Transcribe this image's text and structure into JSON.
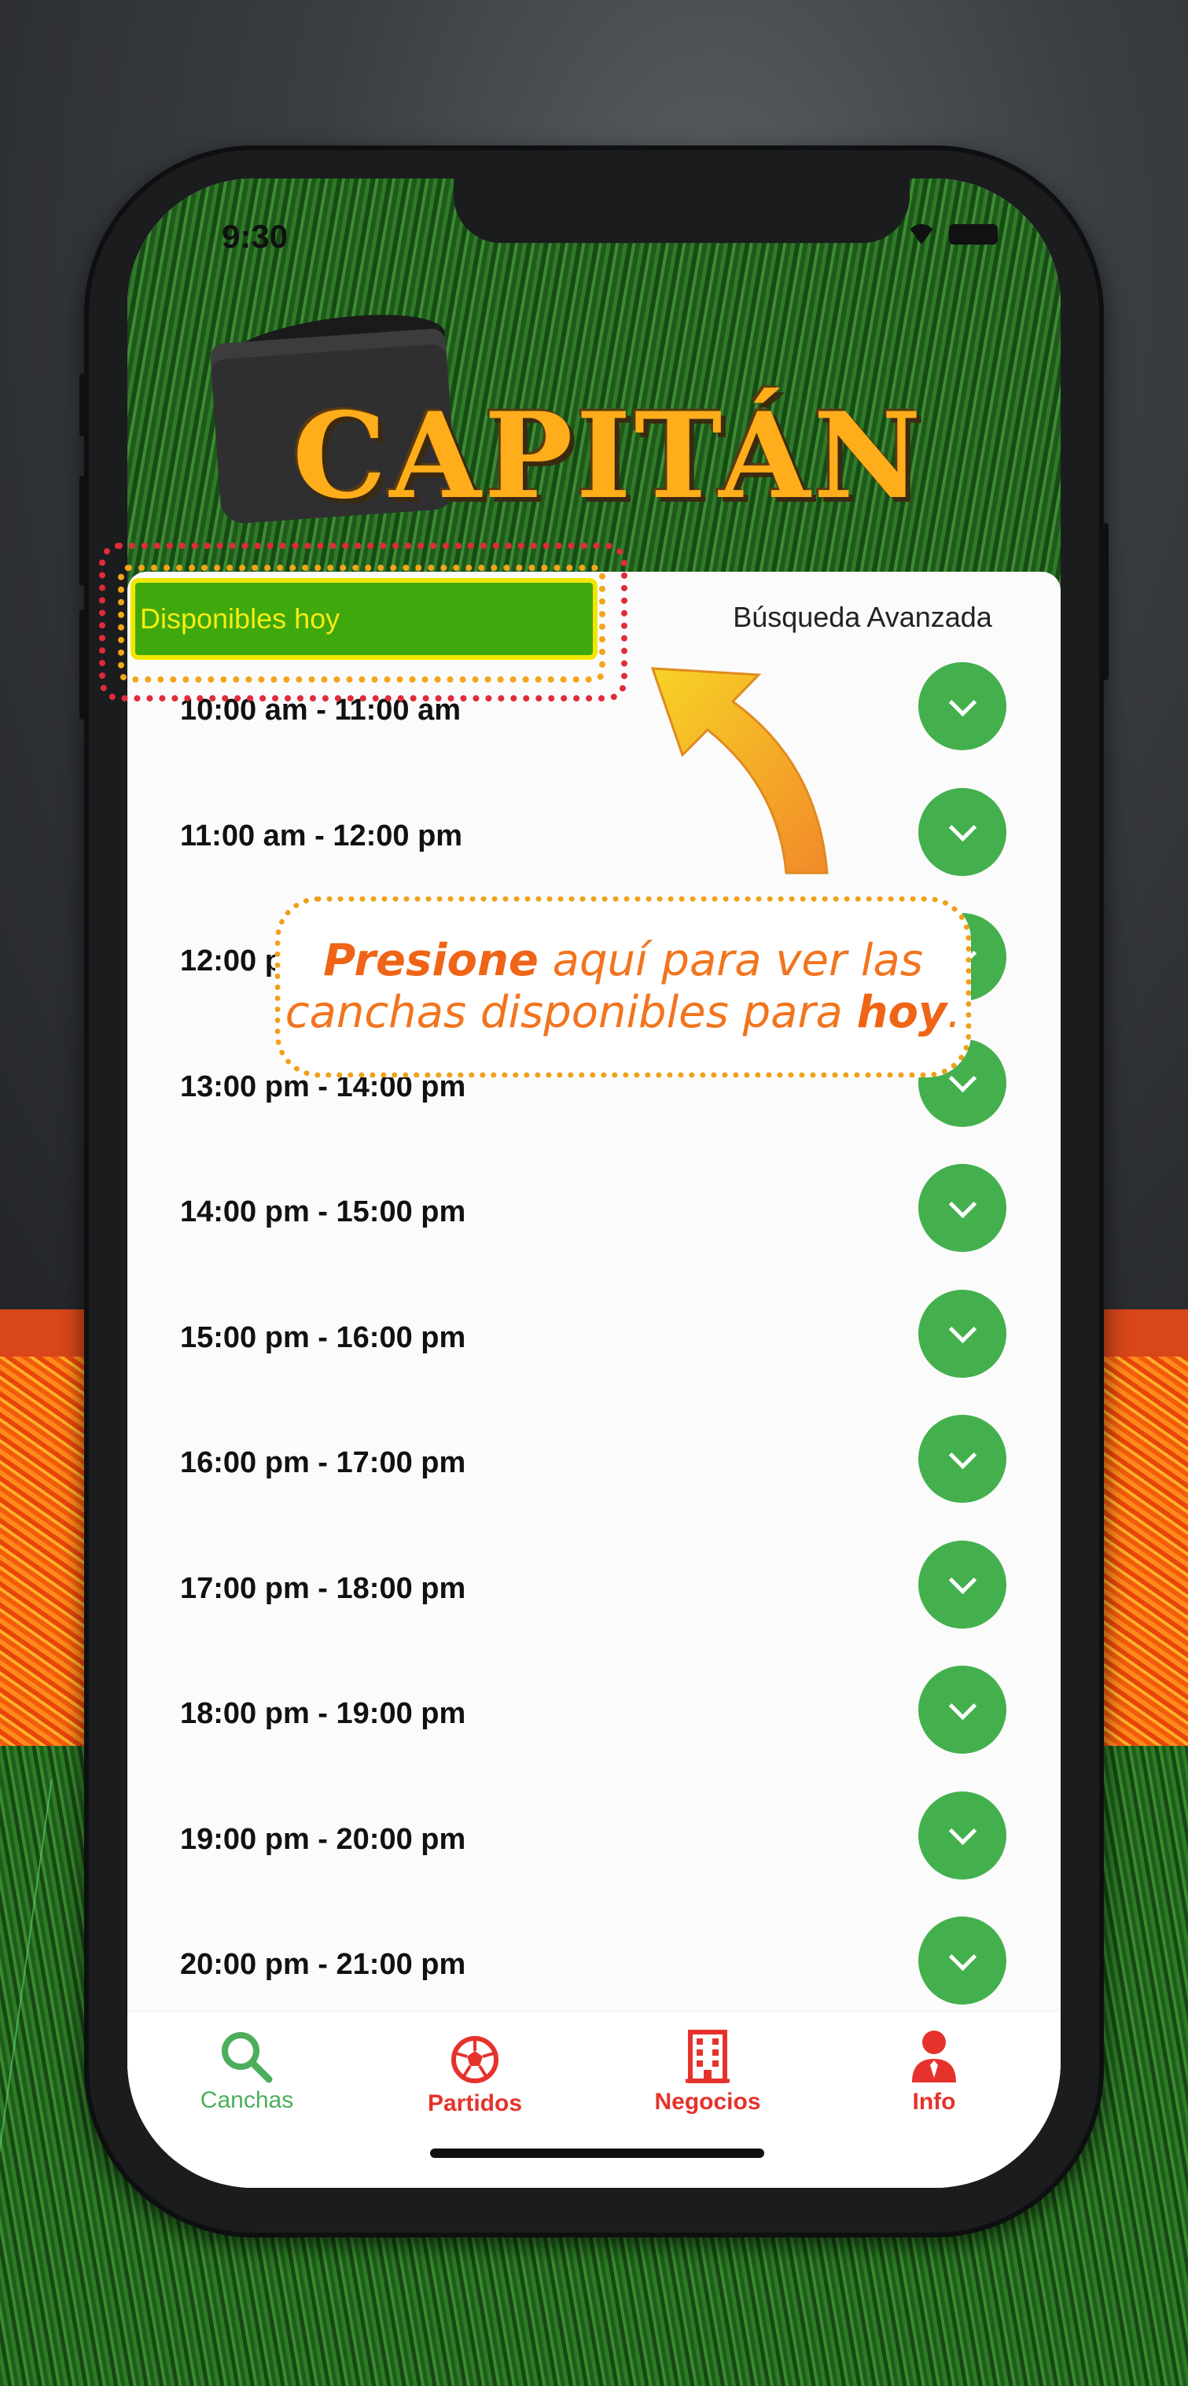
{
  "status": {
    "time": "9:30"
  },
  "header": {
    "logo": "CAPITÁN"
  },
  "tabs": {
    "active": "Disponibles hoy",
    "advanced": "Búsqueda Avanzada"
  },
  "slots": [
    "10:00 am -  11:00 am",
    "11:00 am -  12:00 pm",
    "12:00 pm -  13:00 pm",
    "13:00 pm -  14:00 pm",
    "14:00 pm -  15:00 pm",
    "15:00 pm -  16:00 pm",
    "16:00 pm -  17:00 pm",
    "17:00 pm -  18:00 pm",
    "18:00 pm -  19:00 pm",
    "19:00 pm -  20:00 pm",
    "20:00 pm -  21:00 pm"
  ],
  "tabbar": {
    "canchas": "Canchas",
    "partidos": "Partidos",
    "negocios": "Negocios",
    "info": "Info"
  },
  "callout": {
    "bold1": "Presione",
    "text1": " aquí para ver las",
    "text2": "canchas disponibles para ",
    "bold2": "hoy",
    "end": "."
  },
  "colors": {
    "active_tab": "#3fa80c",
    "active_tab_text": "#f5ec12",
    "slot_button": "#44b04d",
    "tab_green": "#4cae5c",
    "tab_red": "#e6322c",
    "callout_orange": "#f2741f"
  },
  "icons": [
    "wifi-icon",
    "battery-icon",
    "chevron-down-icon",
    "search-icon",
    "soccer-ball-icon",
    "building-icon",
    "person-icon",
    "arrow-icon"
  ]
}
